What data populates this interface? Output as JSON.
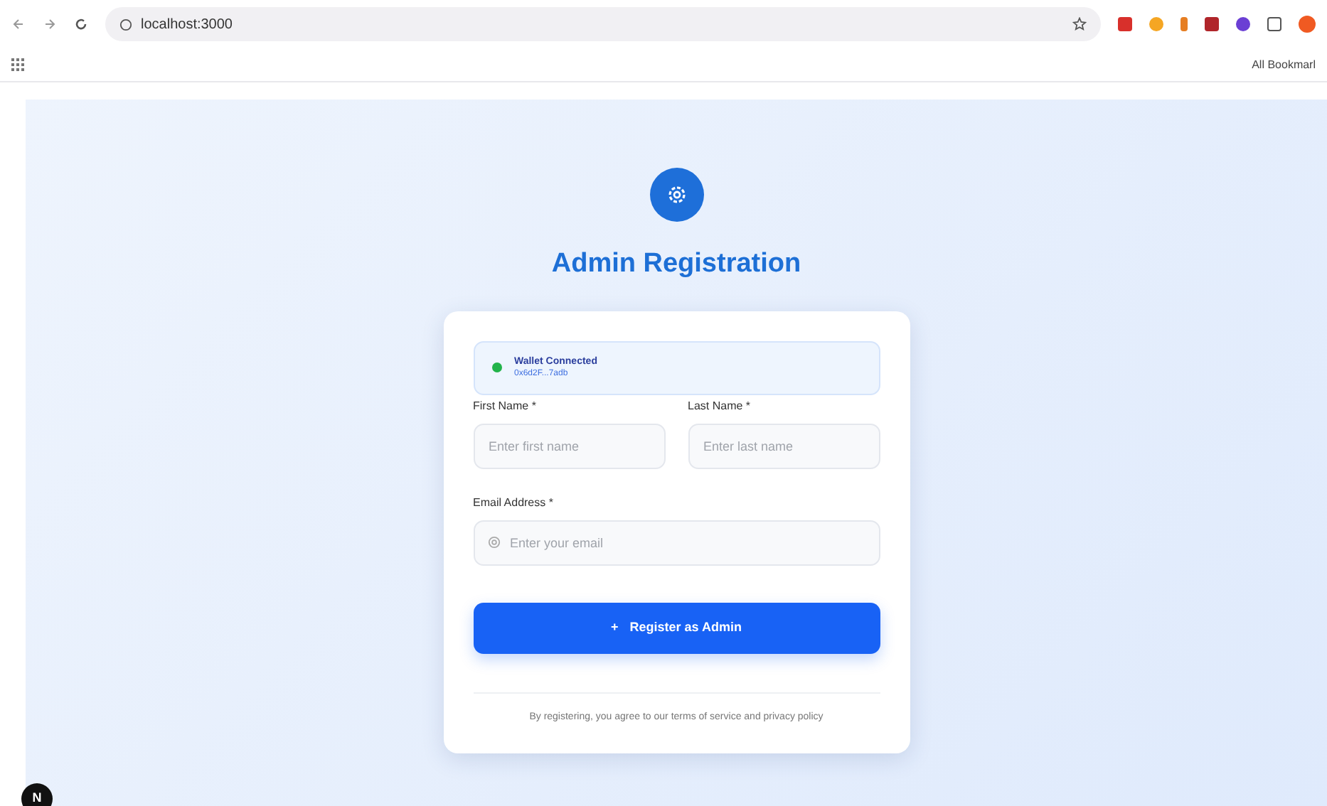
{
  "browser": {
    "url": "localhost:3000",
    "bookmarks_label": "All Bookmarl"
  },
  "header": {
    "title": "Admin Registration"
  },
  "wallet": {
    "connected": true,
    "status": "Wallet Connected",
    "address": "0x6d2F...7adb"
  },
  "fields": [
    {
      "label": "First Name *",
      "placeholder": "Enter first name",
      "kind": "text"
    },
    {
      "label": "Last Name *",
      "placeholder": "Enter last name",
      "kind": "text"
    },
    {
      "label": "Email Address *",
      "placeholder": "Enter your email",
      "kind": "email"
    }
  ],
  "submit": {
    "icon": "+",
    "label": "Register as Admin"
  },
  "terms": "By registering, you agree to our terms of service and privacy policy",
  "dev_badge": "N"
}
